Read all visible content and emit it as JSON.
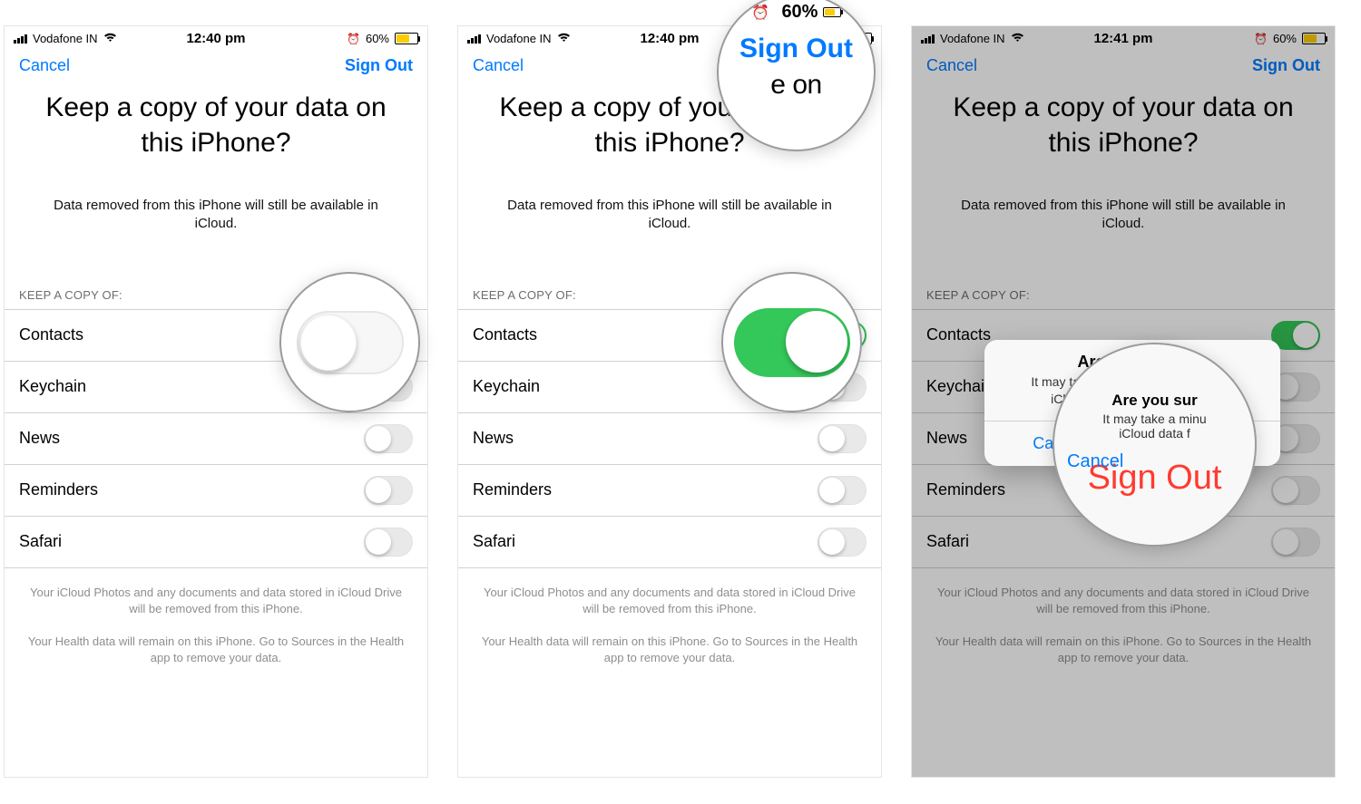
{
  "status": {
    "carrier": "Vodafone IN",
    "time_a": "12:40 pm",
    "time_c": "12:41 pm",
    "battery_pct": "60%"
  },
  "nav": {
    "cancel": "Cancel",
    "signout": "Sign Out"
  },
  "title": "Keep a copy of your data on this iPhone?",
  "subtitle": "Data removed from this iPhone will still be available in iCloud.",
  "section_header": "KEEP A COPY OF:",
  "items": [
    {
      "label": "Contacts"
    },
    {
      "label": "Keychain"
    },
    {
      "label": "News"
    },
    {
      "label": "Reminders"
    },
    {
      "label": "Safari"
    }
  ],
  "footer1": "Your iCloud Photos and any documents and data stored in iCloud Drive will be removed from this iPhone.",
  "footer2": "Your Health data will remain on this iPhone. Go to Sources in the Health app to remove your data.",
  "alert": {
    "title": "Are you sure?",
    "message_line1": "It may take a minute to remove your",
    "message_line2": "iCloud data from this iPhone.",
    "cancel": "Cancel",
    "signout": "Sign Out"
  },
  "mag2": {
    "pct": "60%",
    "signout": "Sign Out",
    "partial": "e on"
  },
  "mag4": {
    "are": "Are you sur",
    "may": "It may take a minu",
    "icloud": "iCloud data f",
    "cancel": "Cancel",
    "signout": "Sign Out"
  }
}
